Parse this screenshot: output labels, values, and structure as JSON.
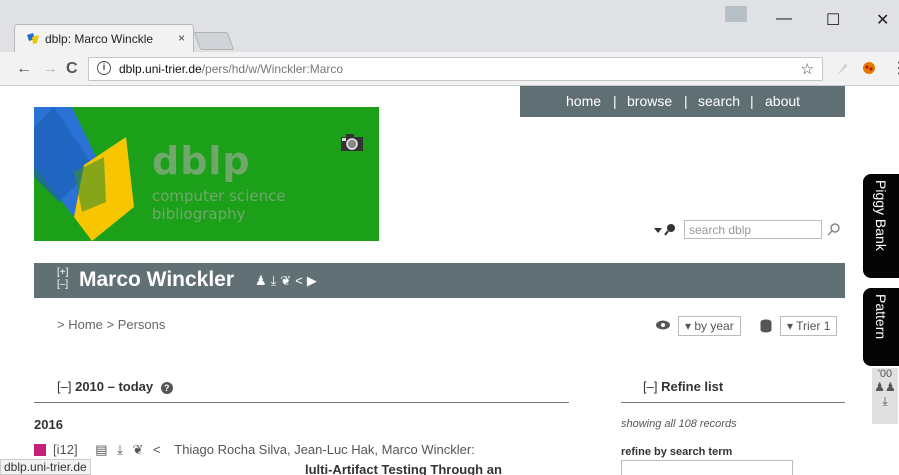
{
  "browser": {
    "tab_title": "dblp: Marco Winckle",
    "tab_close": "×",
    "url_host": "dblp.uni-trier.de",
    "url_path": "/pers/hd/w/Winckler:Marco",
    "info_glyph": "i",
    "star_glyph": "☆",
    "back_glyph": "←",
    "forward_glyph": "→",
    "reload_glyph": "C",
    "menu_glyph": "⋮",
    "minimize_glyph": "—",
    "maximize_glyph": "☐",
    "close_glyph": "✕"
  },
  "site": {
    "logo_title": "dblp",
    "logo_subtitle": "computer science bibliography",
    "nav": [
      "home",
      "browse",
      "search",
      "about"
    ],
    "nav_sep": "|",
    "search_placeholder": "search dblp"
  },
  "person": {
    "expand_plus": "[+]",
    "expand_minus": "[–]",
    "name": "Marco Winckler",
    "icons": "♟⤓❦<▶"
  },
  "breadcrumb": "> Home > Persons",
  "view": {
    "order_label": "by year",
    "style_label": "Trier 1"
  },
  "section": {
    "collapse": "[–]",
    "title": "2010 – today",
    "help_glyph": "?"
  },
  "refine": {
    "collapse": "[–]",
    "title": "Refine list",
    "showing": "showing all 108 records",
    "term_label": "refine by search term"
  },
  "publication": {
    "year": "2016",
    "key": "[i12]",
    "authors": "Thiago Rocha Silva, Jean-Luc Hak, Marco Winckler:",
    "title_fragment": "lulti-Artifact Testing Through an"
  },
  "sidebar": {
    "piggy_bank": "Piggy Bank",
    "pattern": "Pattern",
    "mini_year": "'00"
  },
  "status_bar": "dblp.uni-trier.de",
  "colors": {
    "logo_green": "#1ca01a",
    "header_slate": "#5f6f73",
    "pub_marker": "#c4207a"
  }
}
